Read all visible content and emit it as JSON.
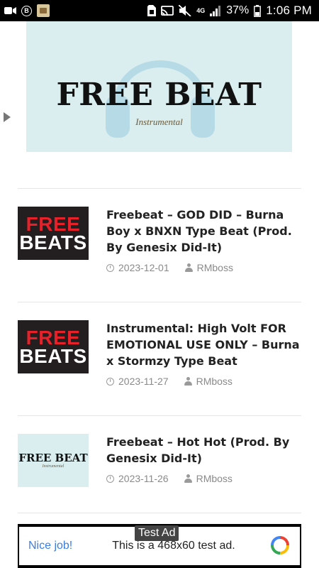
{
  "status_bar": {
    "time": "1:06 PM",
    "battery": "37%",
    "network": "4G",
    "bb_badge": "B"
  },
  "banner": {
    "title": "FREE BEAT",
    "subtitle": "Instrumental"
  },
  "posts": [
    {
      "thumb_line1": "FREE",
      "thumb_line2": "BEATS",
      "title": "Freebeat – GOD DID – Burna Boy x BNXN Type Beat (Prod. By Genesix Did-It)",
      "date": "2023-12-01",
      "author": "RMboss"
    },
    {
      "thumb_line1": "FREE",
      "thumb_line2": "BEATS",
      "title": "Instrumental: High Volt FOR EMOTIONAL USE ONLY – Burna x Stormzy Type Beat",
      "date": "2023-11-27",
      "author": "RMboss"
    },
    {
      "thumb_line1": "FREE BEAT",
      "thumb_line2": "Instrumental",
      "title": "Freebeat – Hot Hot (Prod. By Genesix Did-It)",
      "date": "2023-11-26",
      "author": "RMboss"
    }
  ],
  "ad": {
    "label": "Test Ad",
    "nice": "Nice job!",
    "text": "This is a 468x60 test ad."
  },
  "colors": {
    "banner_bg": "#daeef0",
    "thumb_red": "#e8202a",
    "ad_link": "#3b7de0"
  }
}
